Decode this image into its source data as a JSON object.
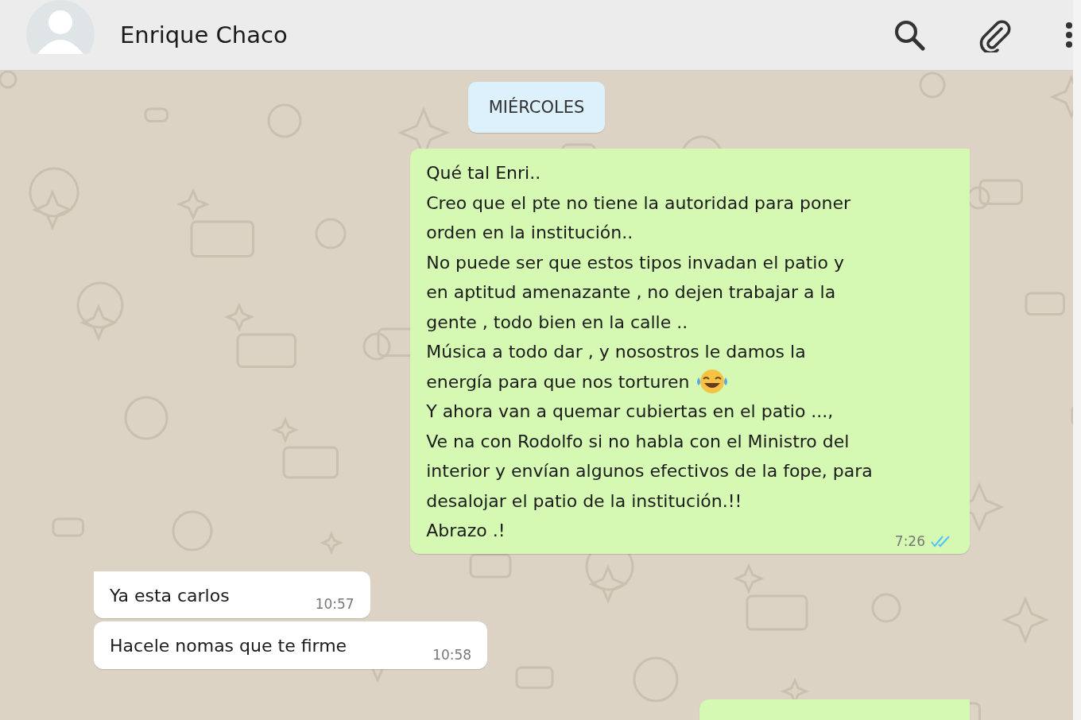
{
  "header": {
    "contact_name": "Enrique Chaco"
  },
  "date_chip": "MIÉRCOLES",
  "messages": [
    {
      "kind": "outgoing",
      "lines": [
        {
          "kind": "text",
          "text": "Qué tal Enri.."
        },
        {
          "kind": "text",
          "text": "Creo que el pte no tiene la autoridad para poner"
        },
        {
          "kind": "text",
          "text": "orden en la institución.."
        },
        {
          "kind": "text",
          "text": "No puede ser que estos tipos invadan el patio y"
        },
        {
          "kind": "text",
          "text": "en aptitud amenazante , no dejen trabajar a la"
        },
        {
          "kind": "text",
          "text": "gente , todo bien en la calle .."
        },
        {
          "kind": "text",
          "text": "Música a todo dar , y nosostros le damos la"
        },
        {
          "kind": "emoji",
          "text": "energía para que nos torturen"
        },
        {
          "kind": "text",
          "text": "Y ahora van a quemar cubiertas en el patio ...,"
        },
        {
          "kind": "text",
          "text": "Ve na con Rodolfo si no habla con el Ministro del"
        },
        {
          "kind": "text",
          "text": "interior y envían algunos efectivos de la fope, para"
        },
        {
          "kind": "text",
          "text": "desalojar el patio de la institución.!!"
        },
        {
          "kind": "text",
          "text": "Abrazo .!"
        }
      ],
      "time": "7:26",
      "read": true
    },
    {
      "kind": "incoming",
      "tail": true,
      "lines": [
        {
          "kind": "text",
          "text": "Ya esta carlos"
        }
      ],
      "time": "10:57"
    },
    {
      "kind": "incoming",
      "tail": false,
      "lines": [
        {
          "kind": "text",
          "text": "Hacele nomas que te firme"
        }
      ],
      "time": "10:58"
    },
    {
      "kind": "outgoing-partial"
    }
  ]
}
